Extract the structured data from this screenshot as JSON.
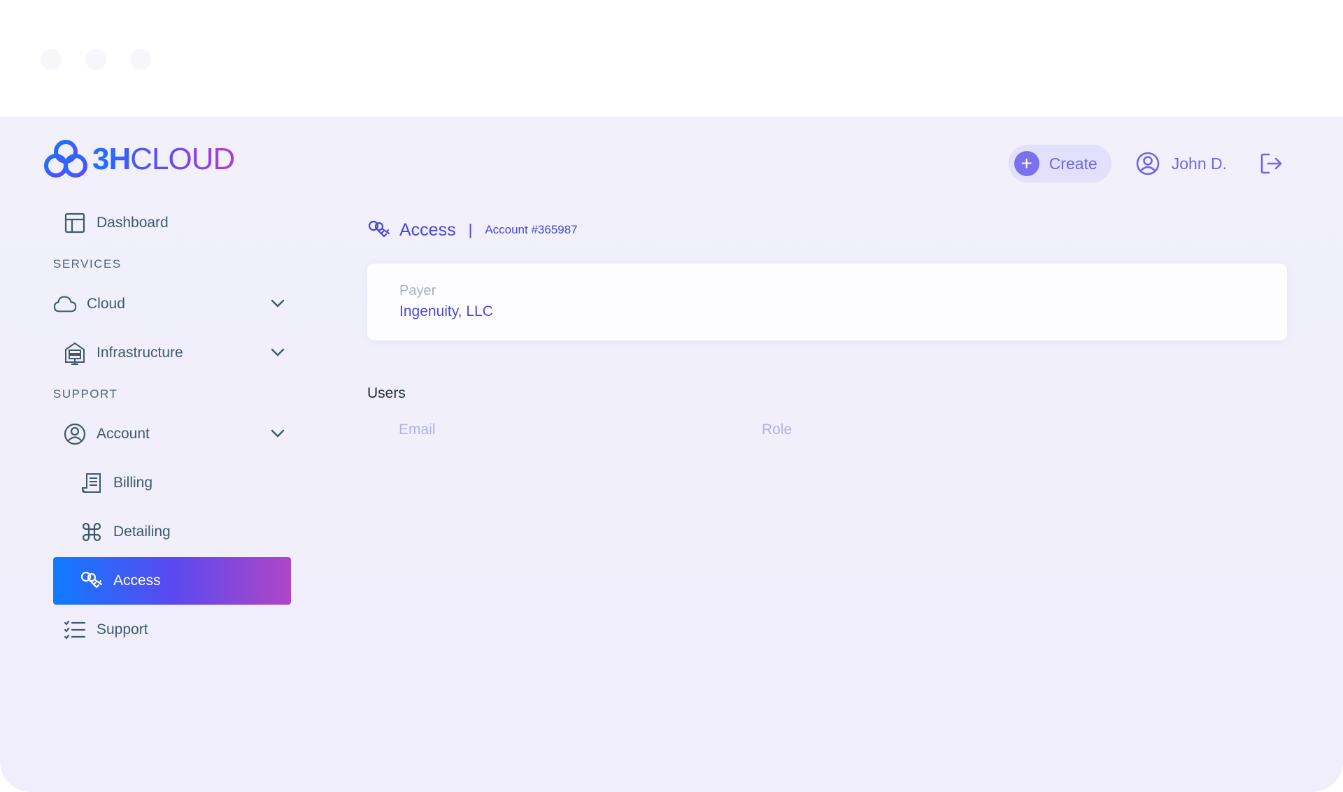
{
  "brand": {
    "name_bold": "3H",
    "name_thin": "CLOUD"
  },
  "header": {
    "create_label": "Create",
    "user_name": "John D."
  },
  "sidebar": {
    "dashboard": "Dashboard",
    "services_label": "SERVICES",
    "cloud": "Cloud",
    "infrastructure": "Infrastructure",
    "support_label": "SUPPORT",
    "account": "Account",
    "billing": "Billing",
    "detailing": "Detailing",
    "access": "Access",
    "support": "Support"
  },
  "main": {
    "title": "Access",
    "separator": "|",
    "account_number": "Account #365987",
    "payer_label": "Payer",
    "payer_value": "Ingenuity, LLC",
    "users_title": "Users",
    "columns": [
      "Email",
      "Role"
    ]
  },
  "colors": {
    "accent": "#4c46d6",
    "sidebar_text": "#3e5a6a",
    "active_gradient_start": "#0f7bff",
    "active_gradient_end": "#b046c6"
  }
}
